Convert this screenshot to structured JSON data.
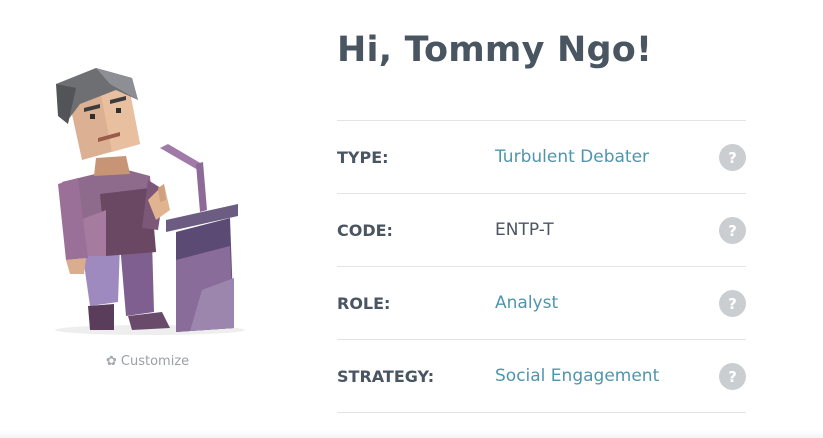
{
  "profile": {
    "greeting": "Hi, Tommy Ngo!",
    "customize_label": "Customize"
  },
  "traits": [
    {
      "label": "TYPE:",
      "value": "Turbulent Debater",
      "is_link": true,
      "help": "?"
    },
    {
      "label": "CODE:",
      "value": "ENTP-T",
      "is_link": false,
      "help": "?"
    },
    {
      "label": "ROLE:",
      "value": "Analyst",
      "is_link": true,
      "help": "?"
    },
    {
      "label": "STRATEGY:",
      "value": "Social Engagement",
      "is_link": true,
      "help": "?"
    }
  ],
  "icons": {
    "customize": "gear-icon",
    "help": "question-circle-icon",
    "avatar": "debater-avatar-illustration"
  },
  "colors": {
    "heading": "#4a5562",
    "link": "#4f95ad",
    "help_bg": "#cbced1",
    "divider": "#e2e4e6",
    "muted": "#9aa0a6"
  }
}
